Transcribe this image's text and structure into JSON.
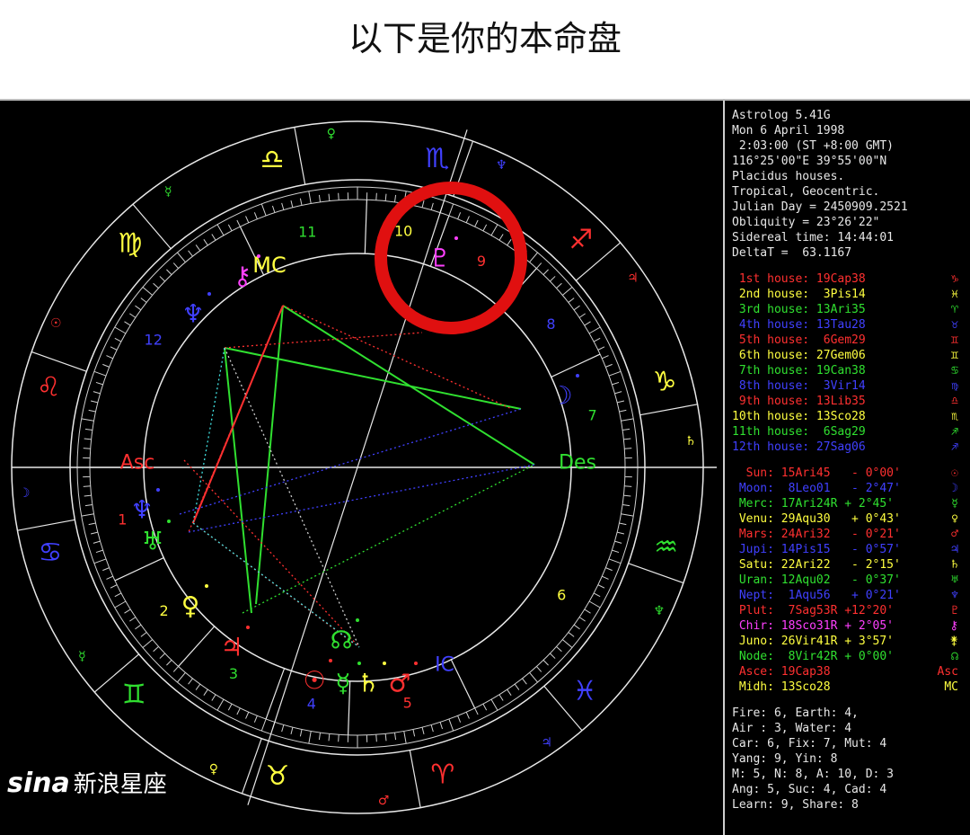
{
  "page_title": "以下是你的本命盘",
  "info_header": [
    "Astrolog 5.41G",
    "Mon 6 April 1998",
    " 2:03:00 (ST +8:00 GMT)",
    "116°25'00\"E 39°55'00\"N",
    "Placidus houses.",
    "Tropical, Geocentric.",
    "Julian Day = 2450909.2521",
    "Obliquity = 23°26'22\"",
    "Sidereal time: 14:44:01",
    "DeltaT =  63.1167"
  ],
  "houses": [
    {
      "label": "1st house:",
      "value": "19Cap38",
      "sign": "♑",
      "color": "#ff3030"
    },
    {
      "label": "2nd house:",
      "value": " 3Pis14",
      "sign": "♓",
      "color": "#ffff40"
    },
    {
      "label": "3rd house:",
      "value": "13Ari35",
      "sign": "♈",
      "color": "#30e030"
    },
    {
      "label": "4th house:",
      "value": "13Tau28",
      "sign": "♉",
      "color": "#4040ff"
    },
    {
      "label": "5th house:",
      "value": " 6Gem29",
      "sign": "♊",
      "color": "#ff3030"
    },
    {
      "label": "6th house:",
      "value": "27Gem06",
      "sign": "♊",
      "color": "#ffff40"
    },
    {
      "label": "7th house:",
      "value": "19Can38",
      "sign": "♋",
      "color": "#30e030"
    },
    {
      "label": "8th house:",
      "value": " 3Vir14",
      "sign": "♍",
      "color": "#4040ff"
    },
    {
      "label": "9th house:",
      "value": "13Lib35",
      "sign": "♎",
      "color": "#ff3030"
    },
    {
      "label": "10th house:",
      "value": "13Sco28",
      "sign": "♏",
      "color": "#ffff40"
    },
    {
      "label": "11th house:",
      "value": " 6Sag29",
      "sign": "♐",
      "color": "#30e030"
    },
    {
      "label": "12th house:",
      "value": "27Sag06",
      "sign": "♐",
      "color": "#4040ff"
    }
  ],
  "planets": [
    {
      "label": "Sun:",
      "value": "15Ari45",
      "speed": " - 0°00'",
      "symbol": "☉",
      "color": "#ff3030"
    },
    {
      "label": "Moon:",
      "value": " 8Leo01",
      "speed": " - 2°47'",
      "symbol": "☽",
      "color": "#4040ff"
    },
    {
      "label": "Merc:",
      "value": "17Ari24R",
      "speed": "+ 2°45'",
      "symbol": "☿",
      "color": "#30e030"
    },
    {
      "label": "Venu:",
      "value": "29Aqu30",
      "speed": " + 0°43'",
      "symbol": "♀",
      "color": "#ffff40"
    },
    {
      "label": "Mars:",
      "value": "24Ari32",
      "speed": " - 0°21'",
      "symbol": "♂",
      "color": "#ff3030"
    },
    {
      "label": "Jupi:",
      "value": "14Pis15",
      "speed": " - 0°57'",
      "symbol": "♃",
      "color": "#4040ff"
    },
    {
      "label": "Satu:",
      "value": "22Ari22",
      "speed": " - 2°15'",
      "symbol": "♄",
      "color": "#ffff40"
    },
    {
      "label": "Uran:",
      "value": "12Aqu02",
      "speed": " - 0°37'",
      "symbol": "♅",
      "color": "#30e030"
    },
    {
      "label": "Nept:",
      "value": " 1Aqu56",
      "speed": " + 0°21'",
      "symbol": "♆",
      "color": "#4040ff"
    },
    {
      "label": "Plut:",
      "value": " 7Sag53R",
      "speed": "+12°20'",
      "symbol": "♇",
      "color": "#ff3030"
    },
    {
      "label": "Chir:",
      "value": "18Sco31R",
      "speed": "+ 2°05'",
      "symbol": "⚷",
      "color": "#ff40ff"
    },
    {
      "label": "Juno:",
      "value": "26Vir41R",
      "speed": "+ 3°57'",
      "symbol": "⚵",
      "color": "#ffff40"
    },
    {
      "label": "Node:",
      "value": " 8Vir42R",
      "speed": "+ 0°00'",
      "symbol": "☊",
      "color": "#30e030"
    },
    {
      "label": "Asce:",
      "value": "19Cap38",
      "speed": "",
      "symbol": "Asc",
      "color": "#ff3030"
    },
    {
      "label": "Midh:",
      "value": "13Sco28",
      "speed": "",
      "symbol": "MC",
      "color": "#ffff40"
    }
  ],
  "summary": [
    "Fire: 6, Earth: 4,",
    "Air : 3, Water: 4",
    "Car: 6, Fix: 7, Mut: 4",
    "Yang: 9, Yin: 8",
    "M: 5, N: 8, A: 10, D: 3",
    "Ang: 5, Suc: 4, Cad: 4",
    "Learn: 9, Share: 8"
  ],
  "watermark": {
    "brand": "sina",
    "text": "新浪星座"
  },
  "wheel": {
    "zodiac_signs": [
      {
        "glyph": "♎",
        "color": "#ffff40"
      },
      {
        "glyph": "♍",
        "color": "#ffff40"
      },
      {
        "glyph": "♌",
        "color": "#ff3030"
      },
      {
        "glyph": "♋",
        "color": "#4040ff"
      },
      {
        "glyph": "♊",
        "color": "#30e030"
      },
      {
        "glyph": "♉",
        "color": "#ffff40"
      },
      {
        "glyph": "♈",
        "color": "#ff3030"
      },
      {
        "glyph": "♓",
        "color": "#4040ff"
      },
      {
        "glyph": "♒",
        "color": "#30e030"
      },
      {
        "glyph": "♑",
        "color": "#ffff40"
      },
      {
        "glyph": "♐",
        "color": "#ff3030"
      },
      {
        "glyph": "♏",
        "color": "#4040ff"
      }
    ],
    "rulers": [
      {
        "glyph": "♀",
        "color": "#30e030"
      },
      {
        "glyph": "☿",
        "color": "#30e030"
      },
      {
        "glyph": "☉",
        "color": "#ff3030"
      },
      {
        "glyph": "☽",
        "color": "#4040ff"
      },
      {
        "glyph": "☿",
        "color": "#30e030"
      },
      {
        "glyph": "♀",
        "color": "#ffff40"
      },
      {
        "glyph": "♂",
        "color": "#ff3030"
      },
      {
        "glyph": "♃",
        "color": "#4040ff"
      },
      {
        "glyph": "♆",
        "color": "#30e030"
      },
      {
        "glyph": "♄",
        "color": "#ffff40"
      },
      {
        "glyph": "♃",
        "color": "#ff3030"
      },
      {
        "glyph": "♆",
        "color": "#4040ff"
      }
    ],
    "house_numbers": [
      {
        "n": "1",
        "color": "#ff3030"
      },
      {
        "n": "2",
        "color": "#ffff40"
      },
      {
        "n": "3",
        "color": "#30e030"
      },
      {
        "n": "4",
        "color": "#4040ff"
      },
      {
        "n": "5",
        "color": "#ff3030"
      },
      {
        "n": "6",
        "color": "#ffff40"
      },
      {
        "n": "7",
        "color": "#30e030"
      },
      {
        "n": "8",
        "color": "#4040ff"
      },
      {
        "n": "9",
        "color": "#ff3030"
      },
      {
        "n": "10",
        "color": "#ffff40"
      },
      {
        "n": "11",
        "color": "#30e030"
      },
      {
        "n": "12",
        "color": "#4040ff"
      }
    ],
    "angle_labels": {
      "asc": "Asc",
      "des": "Des",
      "mc": "MC",
      "ic": "IC"
    },
    "planet_glyphs": [
      {
        "glyph": "☉",
        "color": "#ff3030"
      },
      {
        "glyph": "☽",
        "color": "#4040ff"
      },
      {
        "glyph": "☿",
        "color": "#30e030"
      },
      {
        "glyph": "♀",
        "color": "#ffff40"
      },
      {
        "glyph": "♂",
        "color": "#ff3030"
      },
      {
        "glyph": "♃",
        "color": "#ff3030"
      },
      {
        "glyph": "♄",
        "color": "#ffff40"
      },
      {
        "glyph": "♅",
        "color": "#30e030"
      },
      {
        "glyph": "♆",
        "color": "#4040ff"
      },
      {
        "glyph": "♆",
        "color": "#4040ff"
      },
      {
        "glyph": "♇",
        "color": "#ff40ff"
      },
      {
        "glyph": "⚷",
        "color": "#ff40ff"
      },
      {
        "glyph": "☊",
        "color": "#30e030"
      }
    ],
    "highlight_color": "#e01010"
  }
}
